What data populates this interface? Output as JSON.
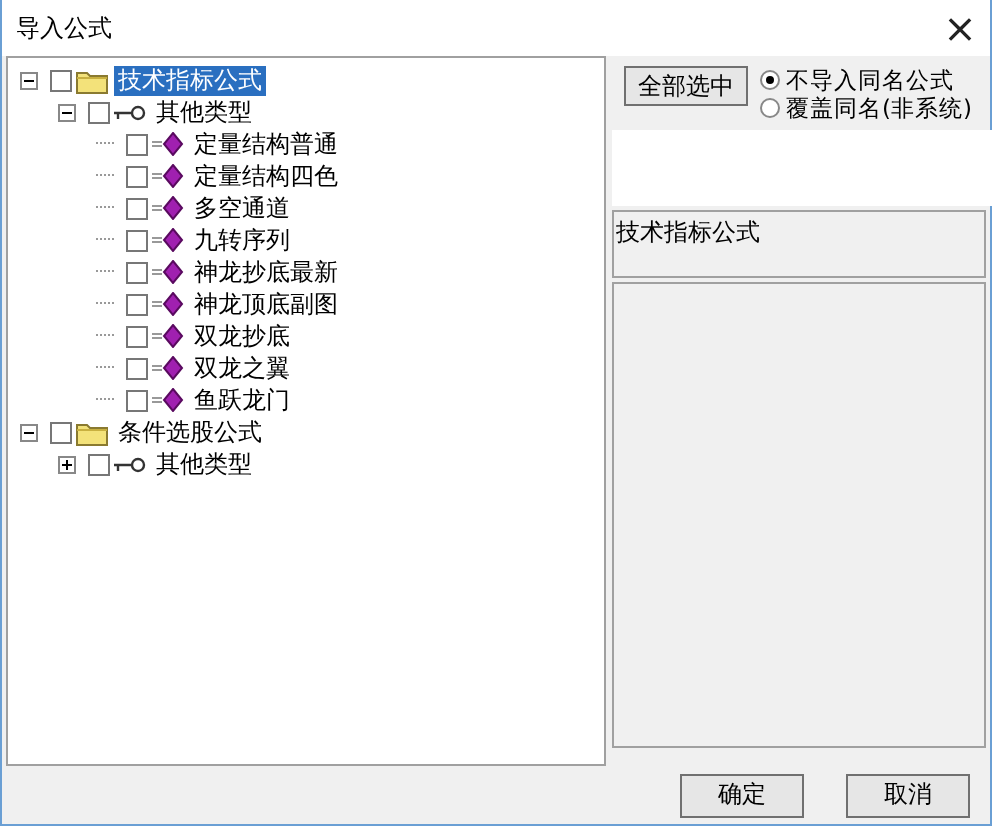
{
  "window": {
    "title": "导入公式",
    "close": "×"
  },
  "tree": [
    {
      "label": "技术指标公式",
      "kind": "folder",
      "expanded": true,
      "checked": false,
      "selected": true,
      "children": [
        {
          "label": "其他类型",
          "kind": "category",
          "expanded": true,
          "checked": false,
          "selected": false,
          "children": [
            {
              "label": "定量结构普通",
              "kind": "formula",
              "checked": false,
              "selected": false
            },
            {
              "label": "定量结构四色",
              "kind": "formula",
              "checked": false,
              "selected": false
            },
            {
              "label": "多空通道",
              "kind": "formula",
              "checked": false,
              "selected": false
            },
            {
              "label": "九转序列",
              "kind": "formula",
              "checked": false,
              "selected": false
            },
            {
              "label": "神龙抄底最新",
              "kind": "formula",
              "checked": false,
              "selected": false
            },
            {
              "label": "神龙顶底副图",
              "kind": "formula",
              "checked": false,
              "selected": false
            },
            {
              "label": "双龙抄底",
              "kind": "formula",
              "checked": false,
              "selected": false
            },
            {
              "label": "双龙之翼",
              "kind": "formula",
              "checked": false,
              "selected": false
            },
            {
              "label": "鱼跃龙门",
              "kind": "formula",
              "checked": false,
              "selected": false
            }
          ]
        }
      ]
    },
    {
      "label": "条件选股公式",
      "kind": "folder",
      "expanded": true,
      "checked": false,
      "selected": false,
      "children": [
        {
          "label": "其他类型",
          "kind": "category",
          "expanded": false,
          "checked": false,
          "selected": false
        }
      ]
    }
  ],
  "select_all_button": "全部选中",
  "import_options": [
    {
      "label": "不导入同名公式",
      "selected": true
    },
    {
      "label": "覆盖同名(非系统)",
      "selected": false
    }
  ],
  "info_label": "技术指标公式",
  "buttons": [
    "确定",
    "取消"
  ]
}
